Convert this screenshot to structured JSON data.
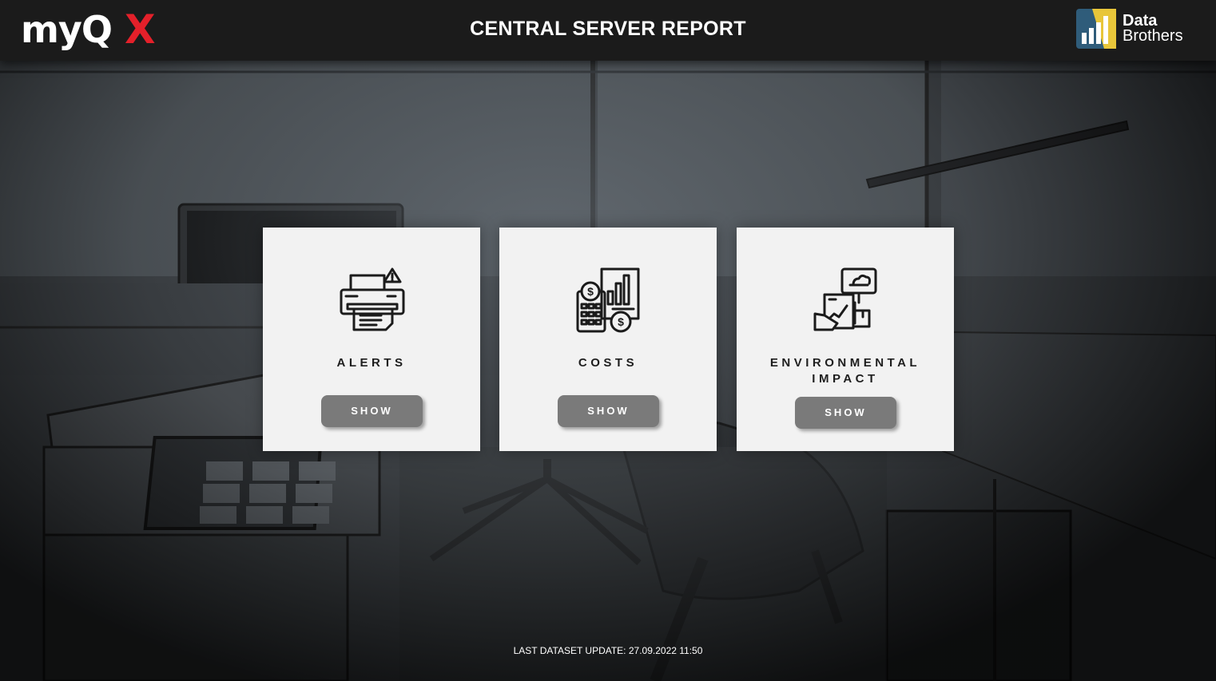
{
  "header": {
    "brand_name": "myQ",
    "brand_suffix": "X",
    "title": "CENTRAL SERVER REPORT",
    "partner_logo": {
      "line1": "Data",
      "line2": "Brothers"
    }
  },
  "cards": [
    {
      "title": "ALERTS",
      "icon": "printer-alert-icon",
      "button_label": "SHOW"
    },
    {
      "title": "COSTS",
      "icon": "calculator-costs-icon",
      "button_label": "SHOW"
    },
    {
      "title": "ENVIRONMENTAL IMPACT",
      "icon": "environmental-chart-icon",
      "button_label": "SHOW"
    }
  ],
  "footer": {
    "last_update": "LAST DATASET UPDATE: 27.09.2022 11:50"
  },
  "colors": {
    "header_bg": "#1b1b1b",
    "brand_accent": "#e4202a",
    "card_bg": "#f2f2f2",
    "button_bg": "#7a7a7a"
  }
}
